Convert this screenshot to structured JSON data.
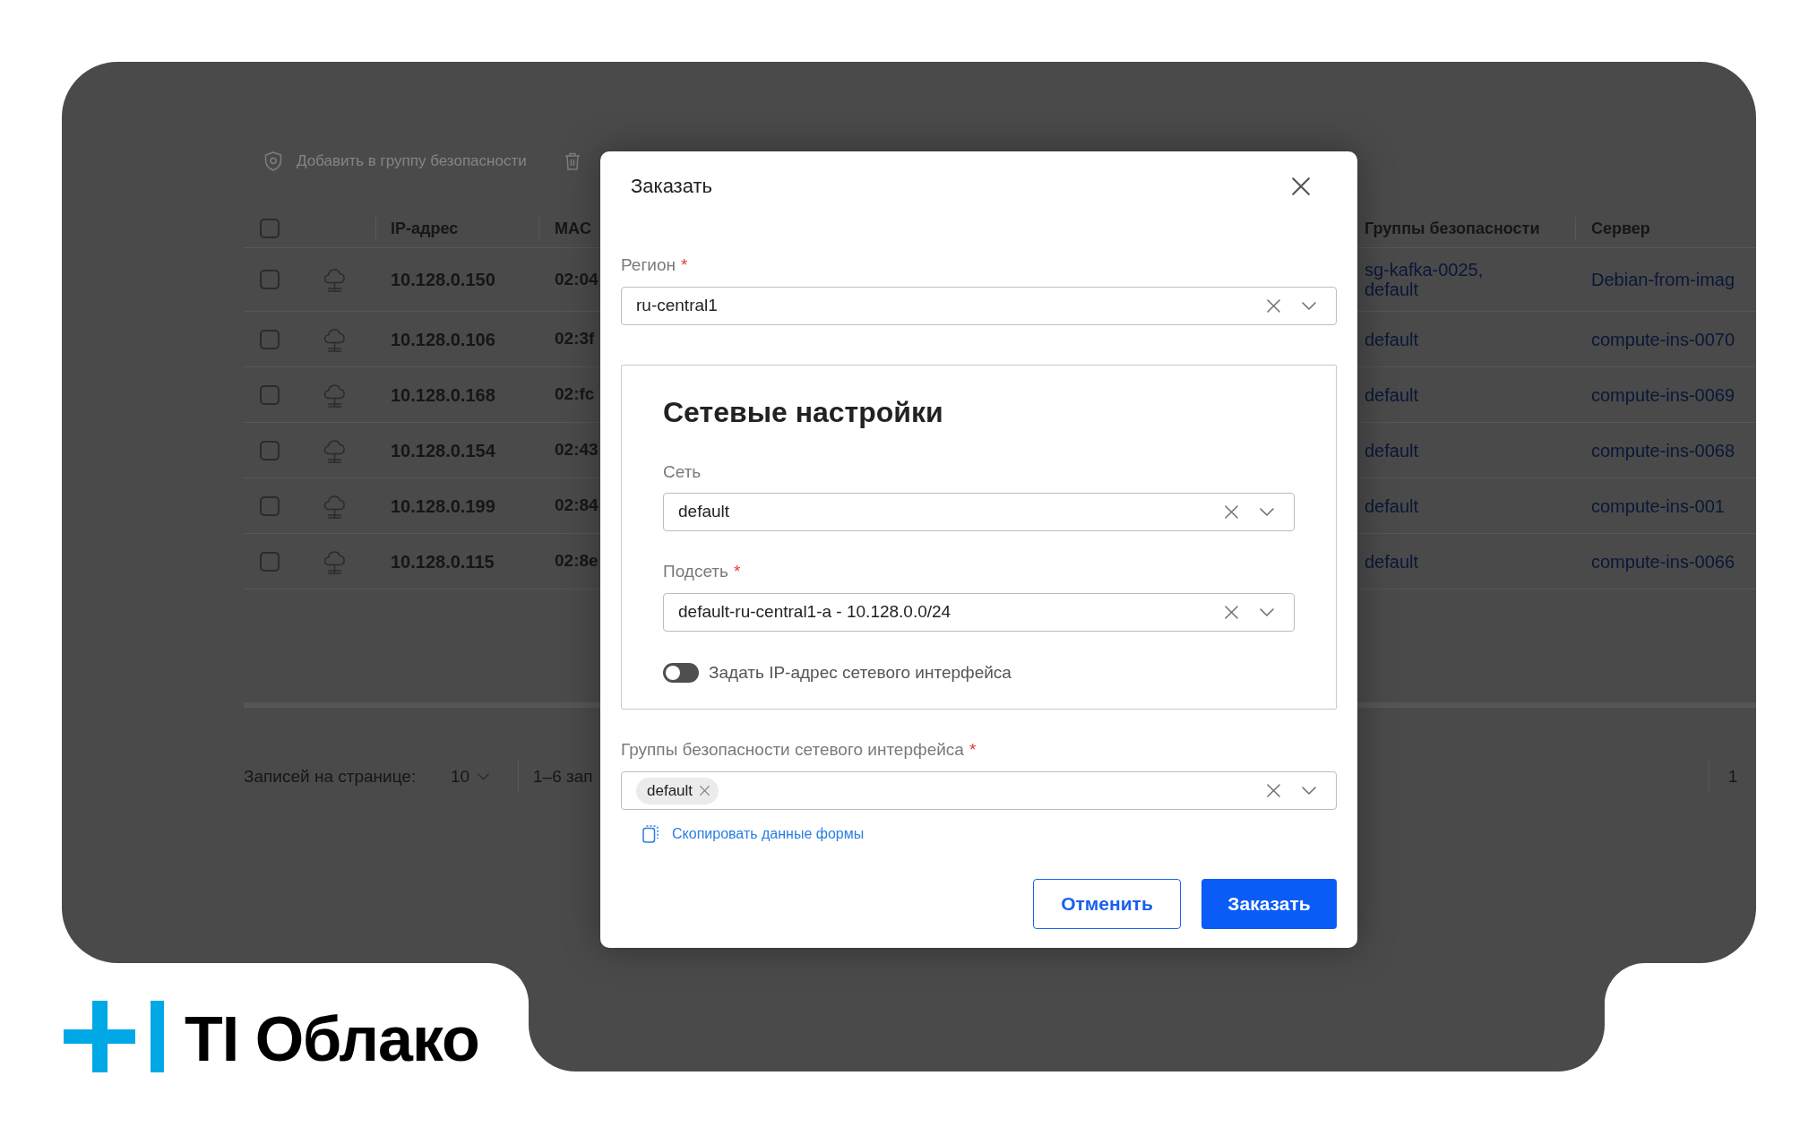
{
  "toolbar": {
    "actions": [
      {
        "kind": "add_to_group",
        "label": "Добавить в группу безопасности",
        "disabled": true
      },
      {
        "kind": "delete",
        "disabled": true
      }
    ]
  },
  "table": {
    "select_all": {
      "checked": false
    },
    "columns": [
      "IP-адрес",
      "MAC",
      "Группы безопасности",
      "Сервер"
    ],
    "rows": [
      {
        "checked": false,
        "ip_address": "10.128.0.150",
        "mac_address": "02:04",
        "security_groups": "sg-kafka-0025, default",
        "server": "Debian-from-imag"
      },
      {
        "checked": false,
        "ip_address": "10.128.0.106",
        "mac_address": "02:3f",
        "security_groups": "default",
        "server": "compute-ins-0070"
      },
      {
        "checked": false,
        "ip_address": "10.128.0.168",
        "mac_address": "02:fc",
        "security_groups": "default",
        "server": "compute-ins-0069"
      },
      {
        "checked": false,
        "ip_address": "10.128.0.154",
        "mac_address": "02:43",
        "security_groups": "default",
        "server": "compute-ins-0068"
      },
      {
        "checked": false,
        "ip_address": "10.128.0.199",
        "mac_address": "02:84",
        "security_groups": "default",
        "server": "compute-ins-001"
      },
      {
        "checked": false,
        "ip_address": "10.128.0.115",
        "mac_address": "02:8e",
        "security_groups": "default",
        "server": "compute-ins-0066"
      }
    ]
  },
  "pagination": {
    "per_page_label": "Записей на странице:",
    "per_page": "10",
    "range": "1–6 зап",
    "page": "1"
  },
  "dialog": {
    "title": "Заказать",
    "region": {
      "label": "Регион",
      "required_mark": "*",
      "value": "ru-central1"
    },
    "network_settings": {
      "title": "Сетевые настройки",
      "network": {
        "label": "Сеть",
        "value": "default"
      },
      "subnet": {
        "label": "Подсеть",
        "required_mark": "*",
        "value": "default-ru-central1-a - 10.128.0.0/24"
      },
      "set_ip": {
        "label": "Задать IP-адрес сетевого интерфейса",
        "on": false
      }
    },
    "security_groups": {
      "label": "Группы безопасности сетевого интерфейса",
      "required_mark": "*",
      "chips": [
        "default"
      ]
    },
    "copy_link": "Скопировать данные формы",
    "buttons": [
      {
        "kind": "secondary",
        "label": "Отменить"
      },
      {
        "kind": "primary",
        "label": "Заказать"
      }
    ]
  },
  "logo": {
    "text": "TI Облако"
  }
}
